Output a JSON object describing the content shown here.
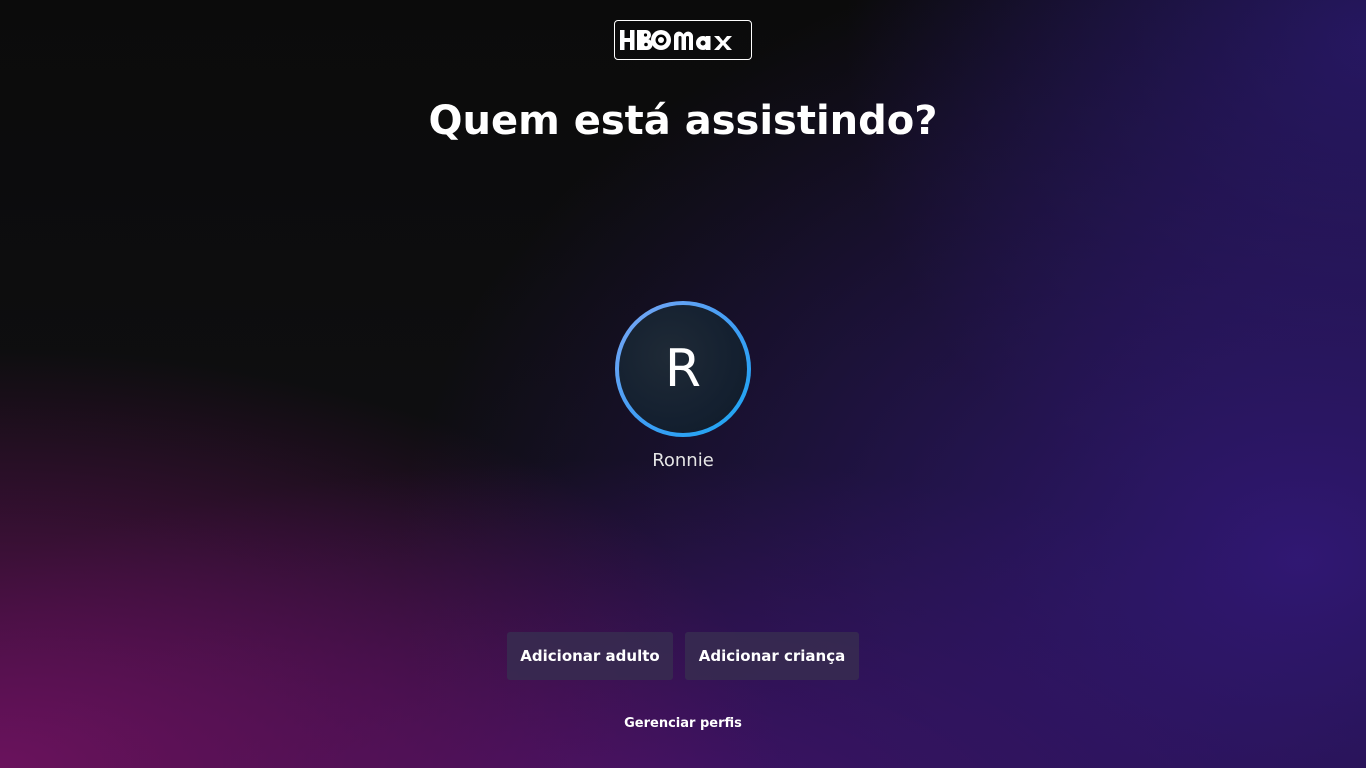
{
  "brand": {
    "logo_text": "HBOmax",
    "logo_icon": "hbo-max-logo"
  },
  "page": {
    "title": "Quem está assistindo?"
  },
  "profiles": [
    {
      "initial": "R",
      "name": "Ronnie",
      "ring_color": "#3d9ef5"
    }
  ],
  "actions": {
    "add_adult_label": "Adicionar adulto",
    "add_kid_label": "Adicionar criança",
    "manage_label": "Gerenciar perfis"
  },
  "colors": {
    "background": "#0c0c0e",
    "accent_purple": "#321878",
    "accent_magenta": "#6e125f",
    "button_bg": "#372d50"
  }
}
